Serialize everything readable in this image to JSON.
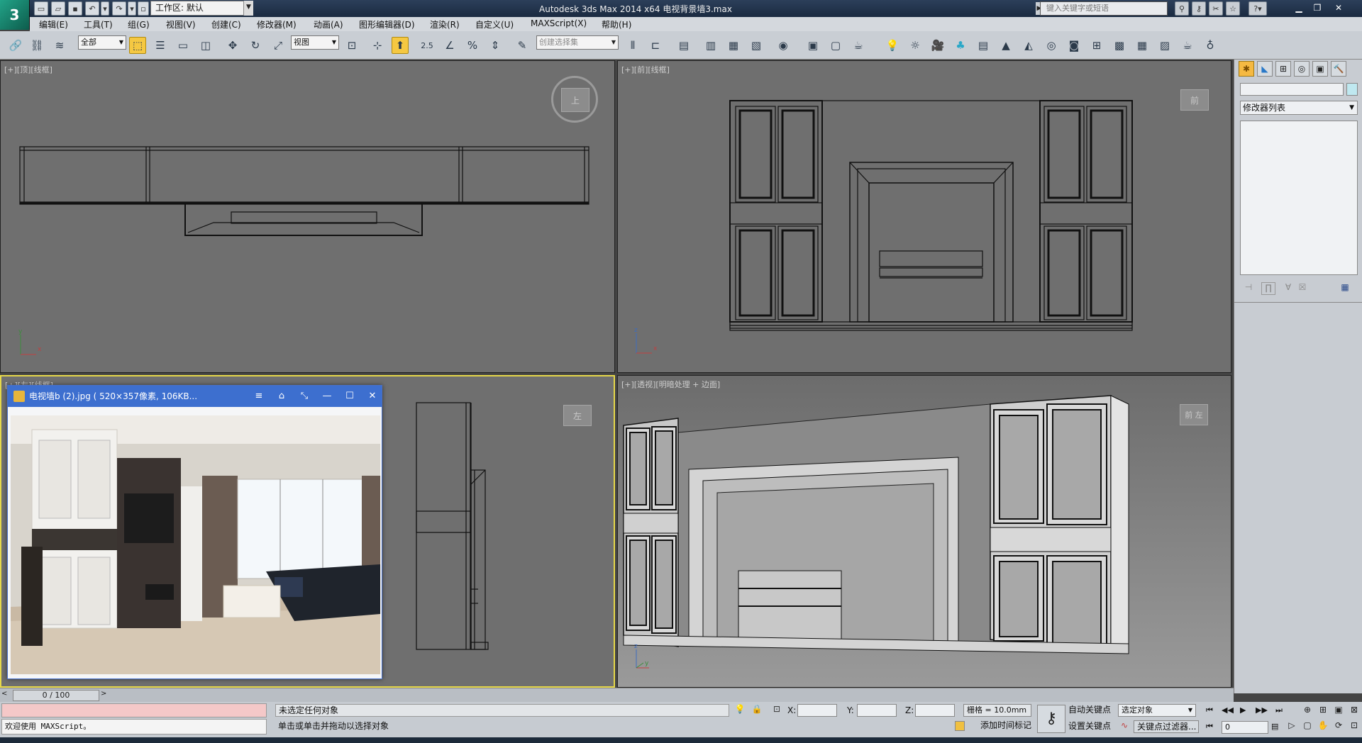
{
  "window": {
    "title": "Autodesk 3ds Max  2014 x64      电视背景墙3.max",
    "workspace": "工作区: 默认",
    "search_placeholder": "键入关键字或短语"
  },
  "menu": [
    "编辑(E)",
    "工具(T)",
    "组(G)",
    "视图(V)",
    "创建(C)",
    "修改器(M)",
    "动画(A)",
    "图形编辑器(D)",
    "渲染(R)",
    "自定义(U)",
    "MAXScript(X)",
    "帮助(H)"
  ],
  "toolbar": {
    "filter": "全部",
    "ref_coord": "视图",
    "snap_value": "2.5",
    "selection_set_placeholder": "创建选择集"
  },
  "viewports": {
    "top": {
      "label": "[+][顶][线框]",
      "cube": "上"
    },
    "front": {
      "label": "[+][前][线框]",
      "cube": "前"
    },
    "left": {
      "label": "[+][左][线框]",
      "cube": "左"
    },
    "perspective": {
      "label": "[+][透视][明暗处理 + 边面]",
      "cube": "前 左"
    }
  },
  "image_viewer": {
    "title": "电视墙b (2).jpg ( 520×357像素, 106KB..."
  },
  "command_panel": {
    "modifier_list": "修改器列表"
  },
  "timeline": {
    "frame": "0 / 100"
  },
  "status": {
    "maxscript_welcome": "欢迎使用 MAXScript。",
    "selection_info": "未选定任何对象",
    "prompt": "单击或单击并拖动以选择对象",
    "x_label": "X:",
    "y_label": "Y:",
    "z_label": "Z:",
    "grid": "栅格 = 10.0mm",
    "auto_key": "自动关键点",
    "set_key": "设置关键点",
    "selected_object": "选定对象",
    "key_filters": "关键点过滤器...",
    "add_time_tag": "添加时间标记",
    "current_frame": "0"
  }
}
